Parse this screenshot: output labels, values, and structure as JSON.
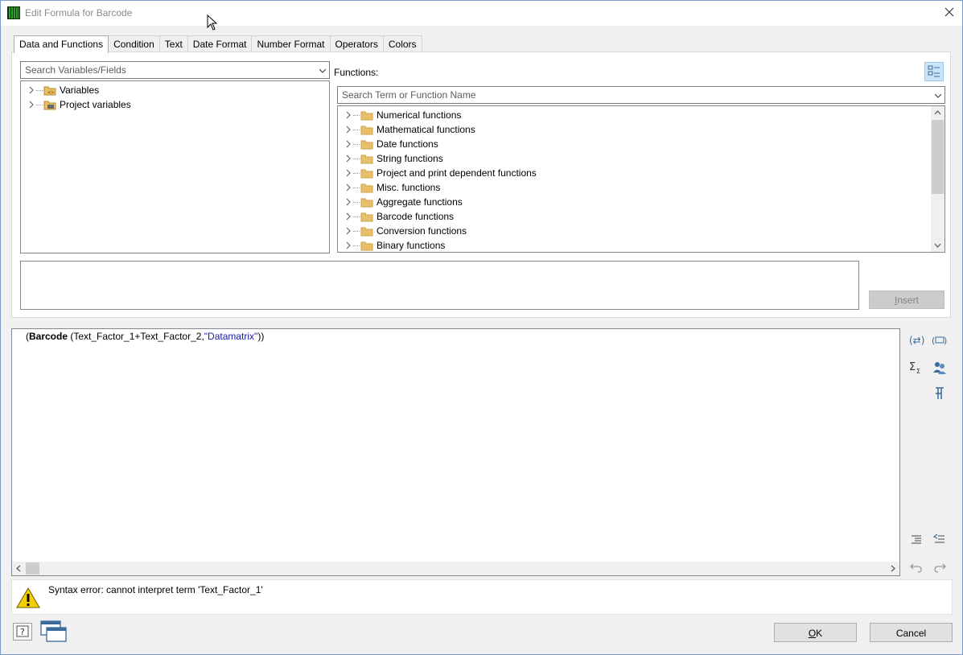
{
  "window": {
    "title": "Edit Formula for Barcode"
  },
  "tabs": [
    {
      "label": "Data and Functions"
    },
    {
      "label": "Condition"
    },
    {
      "label": "Text"
    },
    {
      "label": "Date Format"
    },
    {
      "label": "Number Format"
    },
    {
      "label": "Operators"
    },
    {
      "label": "Colors"
    }
  ],
  "variables": {
    "search_placeholder": "Search Variables/Fields",
    "items": [
      {
        "label": "Variables",
        "icon": "variables-icon"
      },
      {
        "label": "Project variables",
        "icon": "project-variables-icon"
      }
    ]
  },
  "functions": {
    "label": "Functions:",
    "search_placeholder": "Search Term or Function Name",
    "items": [
      {
        "label": "Numerical functions"
      },
      {
        "label": "Mathematical functions"
      },
      {
        "label": "Date functions"
      },
      {
        "label": "String functions"
      },
      {
        "label": "Project and print dependent functions"
      },
      {
        "label": "Misc. functions"
      },
      {
        "label": "Aggregate functions"
      },
      {
        "label": "Barcode functions"
      },
      {
        "label": "Conversion functions"
      },
      {
        "label": "Binary functions"
      }
    ]
  },
  "insert_button": {
    "label_mnemonic": "I",
    "label_rest": "nsert"
  },
  "formula": {
    "open": "(",
    "keyword": "Barcode",
    "args_prefix": " (Text_Factor_1+Text_Factor_2,",
    "string_arg": "\"Datamatrix\"",
    "close": "))"
  },
  "error": {
    "message": "Syntax error: cannot interpret term 'Text_Factor_1'"
  },
  "buttons": {
    "ok_mnemonic": "O",
    "ok_rest": "K",
    "cancel": "Cancel"
  },
  "colors": {
    "accent": "#cce4f7",
    "string_literal": "#1a1aa6",
    "folder": "#e8c06a"
  }
}
